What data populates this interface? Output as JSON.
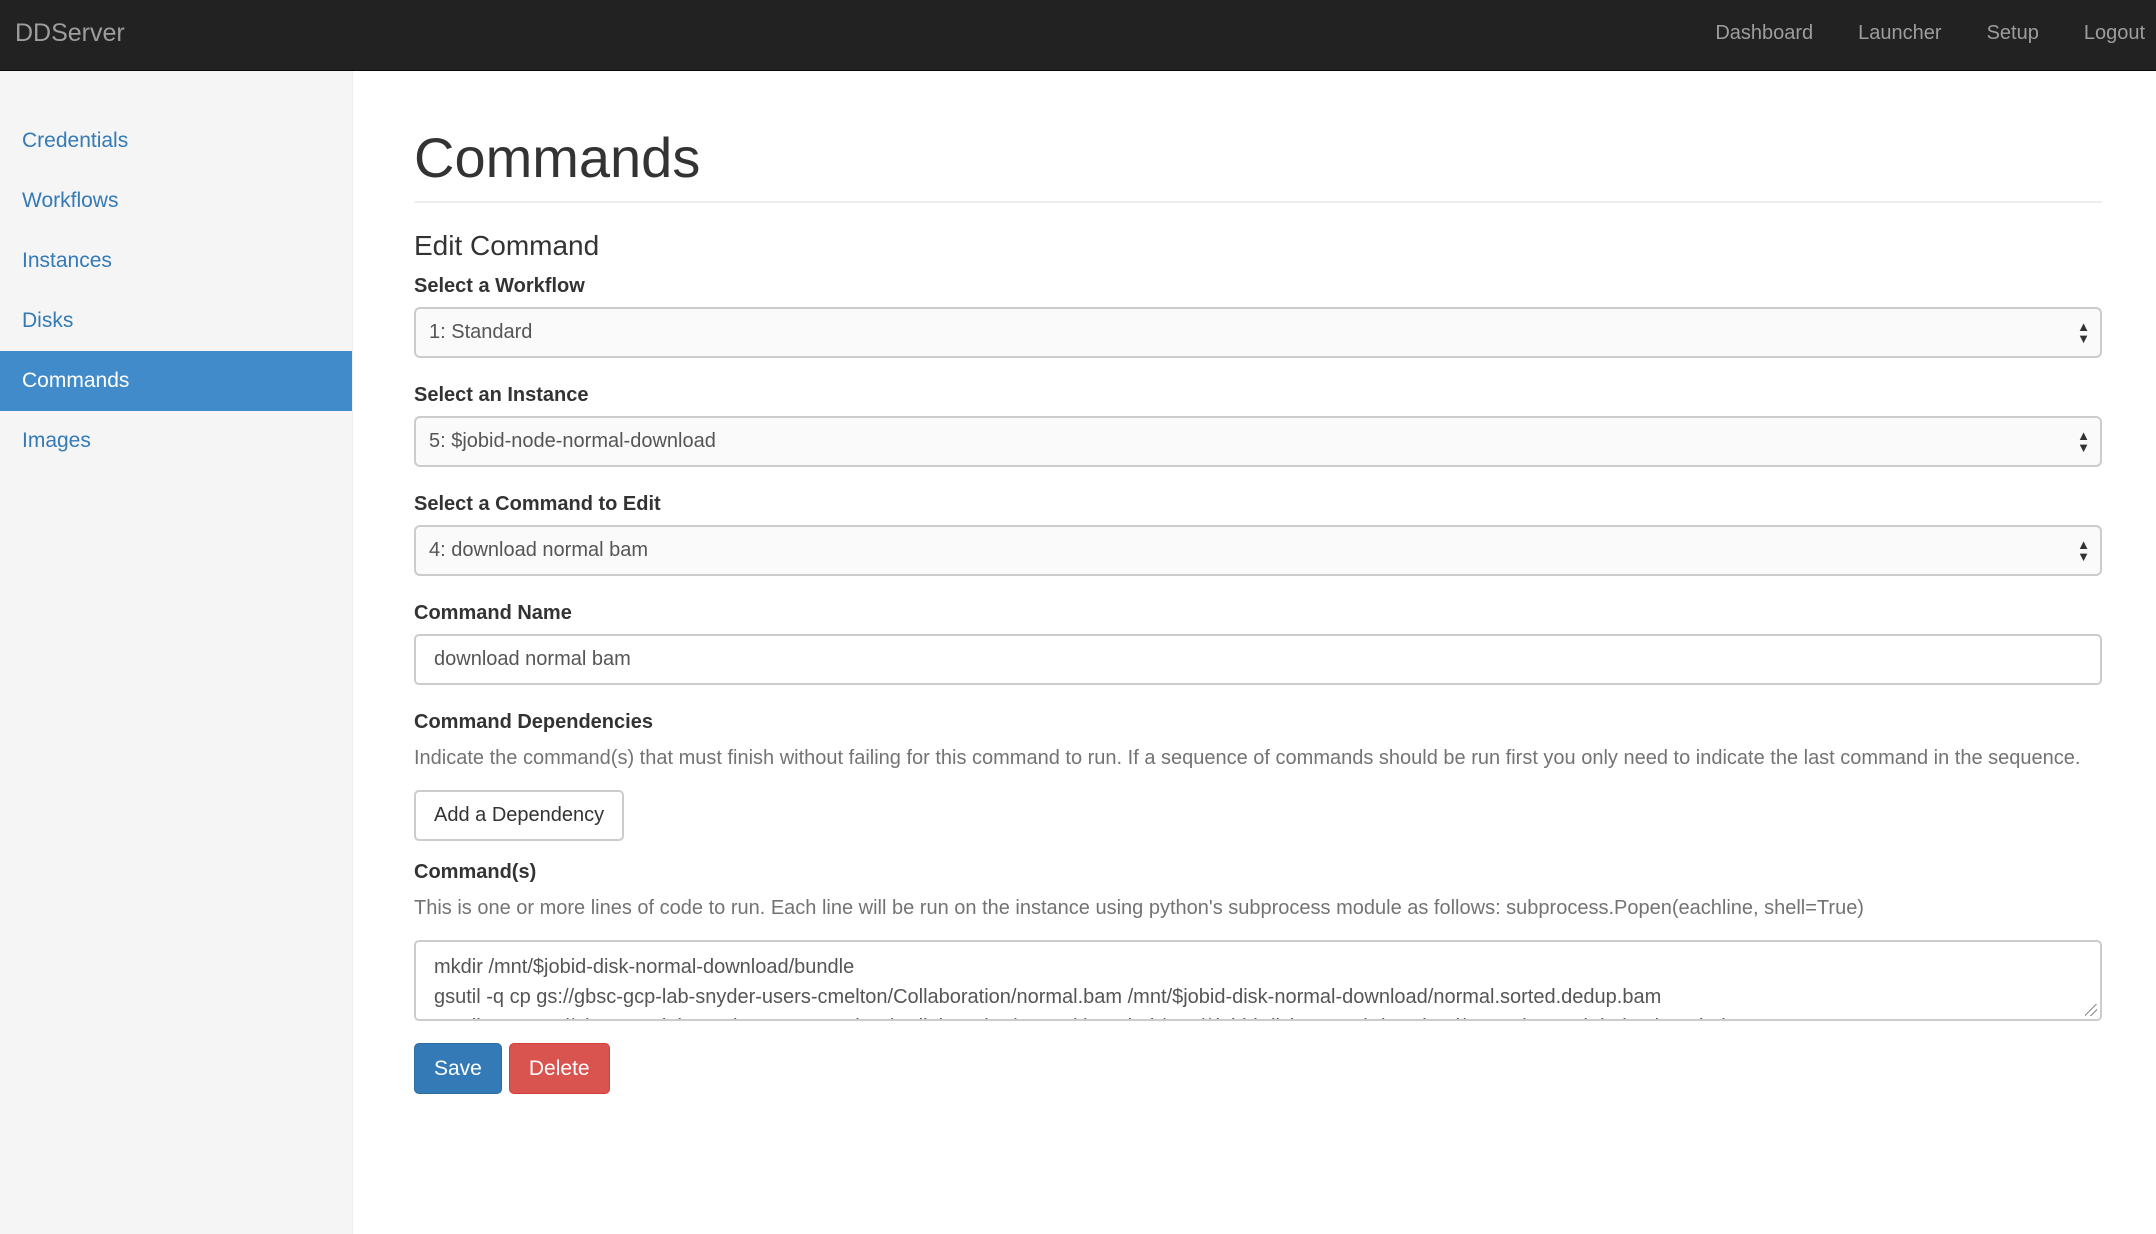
{
  "navbar": {
    "brand": "DDServer",
    "links": [
      "Dashboard",
      "Launcher",
      "Setup",
      "Logout"
    ]
  },
  "sidebar": {
    "items": [
      "Credentials",
      "Workflows",
      "Instances",
      "Disks",
      "Commands",
      "Images"
    ],
    "active": "Commands"
  },
  "page": {
    "title": "Commands",
    "section": "Edit Command"
  },
  "form": {
    "workflow_label": "Select a Workflow",
    "workflow_value": "1: Standard",
    "instance_label": "Select an Instance",
    "instance_value": "5: $jobid-node-normal-download",
    "command_select_label": "Select a Command to Edit",
    "command_select_value": "4: download normal bam",
    "name_label": "Command Name",
    "name_value": "download normal bam",
    "deps_label": "Command Dependencies",
    "deps_help": "Indicate the command(s) that must finish without failing for this command to run. If a sequence of commands should be run first you only need to indicate the last command in the sequence.",
    "add_dependency": "Add a Dependency",
    "commands_label": "Command(s)",
    "commands_help": "This is one or more lines of code to run. Each line will be run on the instance using python's subprocess module as follows: subprocess.Popen(eachline, shell=True)",
    "commands_lines": [
      "mkdir /mnt/$jobid-disk-normal-download/bundle",
      "gsutil -q cp gs://gbsc-gcp-lab-snyder-users-cmelton/Collaboration/normal.bam /mnt/$jobid-disk-normal-download/normal.sorted.dedup.bam",
      "gsutil -q cp gs://gbsc-gcp-lab-snyder-users-cmelton/Collaboration/normal.bam.bai /mnt/$jobid-disk-normal-download/normal.sorted.dedup.bam.bai"
    ],
    "save": "Save",
    "delete": "Delete"
  },
  "colors": {
    "navbar_bg": "#222222",
    "sidebar_active": "#428bca",
    "link": "#337ab7",
    "primary": "#337ab7",
    "danger": "#d9534f"
  },
  "icons": {
    "select_arrows": "select-updown-icon",
    "resize_handle": "resize-grip-icon"
  }
}
